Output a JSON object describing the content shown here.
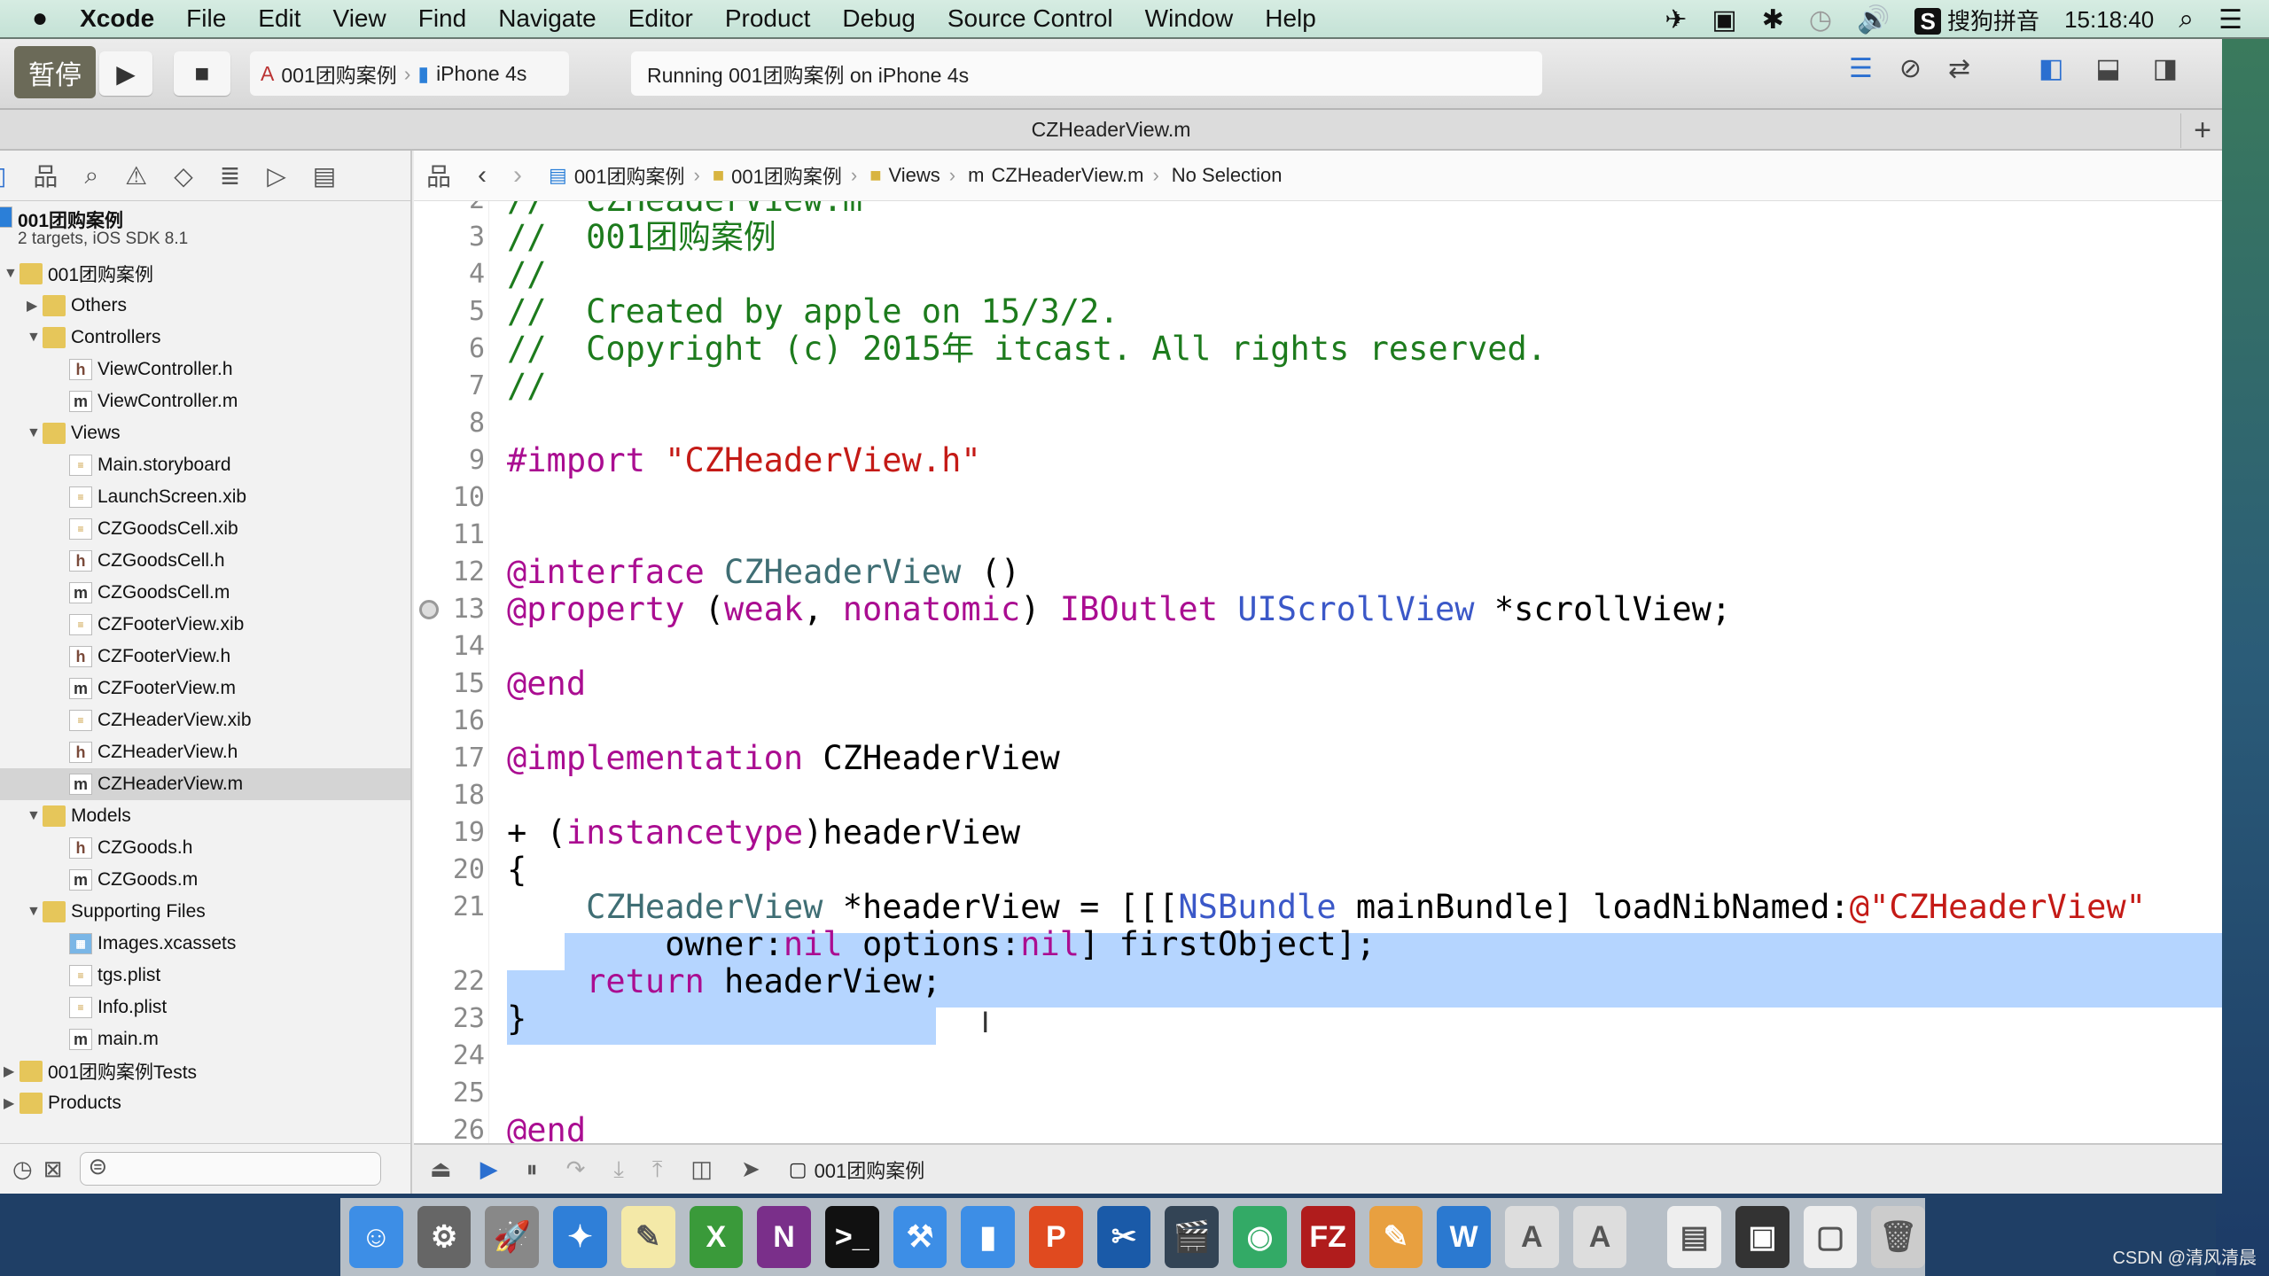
{
  "menubar": {
    "apple": "",
    "app": "Xcode",
    "items": [
      "File",
      "Edit",
      "View",
      "Find",
      "Navigate",
      "Editor",
      "Product",
      "Debug",
      "Source Control",
      "Window",
      "Help"
    ],
    "ime": "搜狗拼音",
    "ime_badge": "S",
    "clock": "15:18:40"
  },
  "toolbar": {
    "pause_label": "暂停",
    "scheme_project": "001团购案例",
    "scheme_device": "iPhone 4s",
    "activity": "Running 001团购案例 on iPhone 4s"
  },
  "tab": {
    "title": "CZHeaderView.m",
    "add": "+"
  },
  "navigator": {
    "project": {
      "name": "001团购案例",
      "subtitle": "2 targets, iOS SDK 8.1"
    },
    "items": [
      {
        "label": "001团购案例",
        "type": "folder",
        "level": 0,
        "disclosure": "▼"
      },
      {
        "label": "Others",
        "type": "folder",
        "level": 1,
        "disclosure": "▶"
      },
      {
        "label": "Controllers",
        "type": "folder",
        "level": 1,
        "disclosure": "▼"
      },
      {
        "label": "ViewController.h",
        "type": "h",
        "level": 2
      },
      {
        "label": "ViewController.m",
        "type": "m",
        "level": 2
      },
      {
        "label": "Views",
        "type": "folder",
        "level": 1,
        "disclosure": "▼"
      },
      {
        "label": "Main.storyboard",
        "type": "x",
        "level": 2
      },
      {
        "label": "LaunchScreen.xib",
        "type": "x",
        "level": 2
      },
      {
        "label": "CZGoodsCell.xib",
        "type": "x",
        "level": 2
      },
      {
        "label": "CZGoodsCell.h",
        "type": "h",
        "level": 2
      },
      {
        "label": "CZGoodsCell.m",
        "type": "m",
        "level": 2
      },
      {
        "label": "CZFooterView.xib",
        "type": "x",
        "level": 2
      },
      {
        "label": "CZFooterView.h",
        "type": "h",
        "level": 2
      },
      {
        "label": "CZFooterView.m",
        "type": "m",
        "level": 2
      },
      {
        "label": "CZHeaderView.xib",
        "type": "x",
        "level": 2
      },
      {
        "label": "CZHeaderView.h",
        "type": "h",
        "level": 2
      },
      {
        "label": "CZHeaderView.m",
        "type": "m",
        "level": 2,
        "selected": true
      },
      {
        "label": "Models",
        "type": "folder",
        "level": 1,
        "disclosure": "▼"
      },
      {
        "label": "CZGoods.h",
        "type": "h",
        "level": 2
      },
      {
        "label": "CZGoods.m",
        "type": "m",
        "level": 2
      },
      {
        "label": "Supporting Files",
        "type": "folder",
        "level": 1,
        "disclosure": "▼"
      },
      {
        "label": "Images.xcassets",
        "type": "a",
        "level": 2
      },
      {
        "label": "tgs.plist",
        "type": "x",
        "level": 2
      },
      {
        "label": "Info.plist",
        "type": "x",
        "level": 2
      },
      {
        "label": "main.m",
        "type": "m",
        "level": 2
      },
      {
        "label": "001团购案例Tests",
        "type": "folder",
        "level": 0,
        "disclosure": "▶"
      },
      {
        "label": "Products",
        "type": "folder",
        "level": 0,
        "disclosure": "▶"
      }
    ]
  },
  "jumpbar": [
    "001团购案例",
    "001团购案例",
    "Views",
    "CZHeaderView.m",
    "No Selection"
  ],
  "code": {
    "lines": [
      {
        "n": "2",
        "t": [
          [
            "c-comment",
            "//  CZHeaderView.m"
          ]
        ]
      },
      {
        "n": "3",
        "t": [
          [
            "c-comment",
            "//  001团购案例"
          ]
        ]
      },
      {
        "n": "4",
        "t": [
          [
            "c-comment",
            "//"
          ]
        ]
      },
      {
        "n": "5",
        "t": [
          [
            "c-comment",
            "//  Created by apple on 15/3/2."
          ]
        ]
      },
      {
        "n": "6",
        "t": [
          [
            "c-comment",
            "//  Copyright (c) 2015年 itcast. All rights reserved."
          ]
        ]
      },
      {
        "n": "7",
        "t": [
          [
            "c-comment",
            "//"
          ]
        ]
      },
      {
        "n": "8",
        "t": []
      },
      {
        "n": "9",
        "t": [
          [
            "c-kw",
            "#import "
          ],
          [
            "c-str",
            "\"CZHeaderView.h\""
          ]
        ]
      },
      {
        "n": "10",
        "t": []
      },
      {
        "n": "11",
        "t": []
      },
      {
        "n": "12",
        "t": [
          [
            "c-kw",
            "@interface "
          ],
          [
            "c-class",
            "CZHeaderView"
          ],
          [
            "c-plain",
            " ()"
          ]
        ]
      },
      {
        "n": "13",
        "t": [
          [
            "c-kw",
            "@property "
          ],
          [
            "c-plain",
            "("
          ],
          [
            "c-kw",
            "weak"
          ],
          [
            "c-plain",
            ", "
          ],
          [
            "c-kw",
            "nonatomic"
          ],
          [
            "c-plain",
            ") "
          ],
          [
            "c-kw",
            "IBOutlet "
          ],
          [
            "c-type",
            "UIScrollView"
          ],
          [
            "c-plain",
            " *scrollView;"
          ]
        ],
        "breakpoint": true
      },
      {
        "n": "14",
        "t": []
      },
      {
        "n": "15",
        "t": [
          [
            "c-kw",
            "@end"
          ]
        ]
      },
      {
        "n": "16",
        "t": []
      },
      {
        "n": "17",
        "t": [
          [
            "c-kw",
            "@implementation "
          ],
          [
            "c-plain",
            "CZHeaderView"
          ]
        ]
      },
      {
        "n": "18",
        "t": []
      },
      {
        "n": "19",
        "t": [
          [
            "c-plain",
            "+ ("
          ],
          [
            "c-kw",
            "instancetype"
          ],
          [
            "c-plain",
            ")headerView"
          ]
        ]
      },
      {
        "n": "20",
        "t": [
          [
            "c-plain",
            "{"
          ]
        ]
      },
      {
        "n": "21",
        "t": [
          [
            "c-plain",
            "    "
          ],
          [
            "c-class",
            "CZHeaderView"
          ],
          [
            "c-plain",
            " *headerView = [[["
          ],
          [
            "c-type",
            "NSBundle"
          ],
          [
            "c-plain",
            " mainBundle] loadNibNamed:"
          ],
          [
            "c-str",
            "@\"CZHeaderView\""
          ]
        ],
        "selected": true
      },
      {
        "n": "",
        "t": [
          [
            "c-plain",
            "        owner:"
          ],
          [
            "c-kw",
            "nil"
          ],
          [
            "c-plain",
            " options:"
          ],
          [
            "c-kw",
            "nil"
          ],
          [
            "c-plain",
            "] firstObject];"
          ]
        ],
        "selected": true
      },
      {
        "n": "22",
        "t": [
          [
            "c-plain",
            "    "
          ],
          [
            "c-kw",
            "return"
          ],
          [
            "c-plain",
            " headerView;"
          ]
        ],
        "selected": true
      },
      {
        "n": "23",
        "t": [
          [
            "c-plain",
            "}"
          ]
        ]
      },
      {
        "n": "24",
        "t": []
      },
      {
        "n": "25",
        "t": []
      },
      {
        "n": "26",
        "t": [
          [
            "c-kw",
            "@end"
          ]
        ]
      }
    ]
  },
  "debugbar": {
    "process": "001团购案例"
  },
  "dock": [
    {
      "name": "finder",
      "bg": "#3d8ee6",
      "glyph": "☺"
    },
    {
      "name": "system-preferences",
      "bg": "#666",
      "glyph": "⚙"
    },
    {
      "name": "launchpad",
      "bg": "#888",
      "glyph": "🚀"
    },
    {
      "name": "safari",
      "bg": "#2f7fd8",
      "glyph": "✦"
    },
    {
      "name": "notes",
      "bg": "#f4e9a8",
      "glyph": "✎"
    },
    {
      "name": "excel",
      "bg": "#3a9a3a",
      "glyph": "X"
    },
    {
      "name": "onenote",
      "bg": "#7a2f8a",
      "glyph": "N"
    },
    {
      "name": "terminal",
      "bg": "#111",
      "glyph": ">_"
    },
    {
      "name": "xcode-folder",
      "bg": "#3d8ee6",
      "glyph": "⚒"
    },
    {
      "name": "folder",
      "bg": "#3d8ee6",
      "glyph": "▮"
    },
    {
      "name": "powerpoint",
      "bg": "#e04a1f",
      "glyph": "P"
    },
    {
      "name": "snipping",
      "bg": "#1a5aa8",
      "glyph": "✂"
    },
    {
      "name": "imovie",
      "bg": "#345",
      "glyph": "🎬"
    },
    {
      "name": "network-app",
      "bg": "#3a6",
      "glyph": "◉"
    },
    {
      "name": "filezilla",
      "bg": "#b01c1c",
      "glyph": "FZ"
    },
    {
      "name": "instruments",
      "bg": "#e8a040",
      "glyph": "✎"
    },
    {
      "name": "word",
      "bg": "#2b79d0",
      "glyph": "W"
    },
    {
      "name": "xcode-doc-1",
      "bg": "#ddd",
      "glyph": "A"
    },
    {
      "name": "xcode-doc-2",
      "bg": "#ddd",
      "glyph": "A"
    },
    {
      "name": "stack-1",
      "bg": "#eee",
      "glyph": "▤"
    },
    {
      "name": "stack-2",
      "bg": "#333",
      "glyph": "▣"
    },
    {
      "name": "stack-3",
      "bg": "#eee",
      "glyph": "▢"
    },
    {
      "name": "trash",
      "bg": "#ccc",
      "glyph": "🗑"
    }
  ],
  "watermark": "CSDN @清风清晨"
}
